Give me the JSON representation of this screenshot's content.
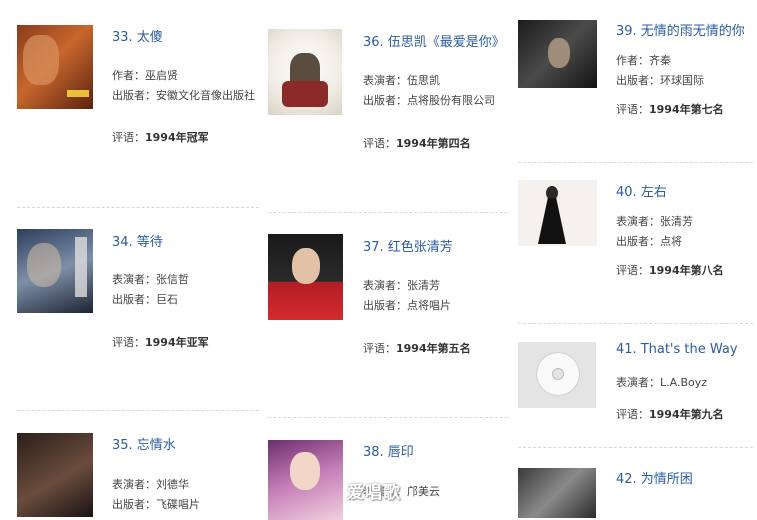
{
  "labels": {
    "author": "作者",
    "performer": "表演者",
    "publisher": "出版者",
    "review": "评语",
    "sep": "："
  },
  "albums": [
    {
      "num": "33.",
      "title": "太傻",
      "role": "author",
      "person": "巫启贤",
      "publisher": "安徽文化音像出版社",
      "review": "1994年冠军"
    },
    {
      "num": "34.",
      "title": "等待",
      "role": "performer",
      "person": "张信哲",
      "publisher": "巨石",
      "review": "1994年亚军"
    },
    {
      "num": "35.",
      "title": "忘情水",
      "role": "performer",
      "person": "刘德华",
      "publisher": "飞碟唱片",
      "review": ""
    },
    {
      "num": "36.",
      "title": "伍思凯《最爱是你》",
      "role": "performer",
      "person": "伍思凯",
      "publisher": "点将股份有限公司",
      "review": "1994年第四名"
    },
    {
      "num": "37.",
      "title": "红色张清芳",
      "role": "performer",
      "person": "张清芳",
      "publisher": "点将唱片",
      "review": "1994年第五名"
    },
    {
      "num": "38.",
      "title": "唇印",
      "role": "performer",
      "person": "邝美云",
      "publisher": "",
      "review": ""
    },
    {
      "num": "39.",
      "title": "无情的雨无情的你",
      "role": "author",
      "person": "齐秦",
      "publisher": "环球国际",
      "review": "1994年第七名"
    },
    {
      "num": "40.",
      "title": "左右",
      "role": "performer",
      "person": "张清芳",
      "publisher": "点将",
      "review": "1994年第八名"
    },
    {
      "num": "41.",
      "title": "That's the Way",
      "role": "performer",
      "person": "L.A.Boyz",
      "publisher": "",
      "review": "1994年第九名"
    },
    {
      "num": "42.",
      "title": "为情所困",
      "role": "",
      "person": "",
      "publisher": "",
      "review": ""
    }
  ],
  "watermark": "爱唱歌",
  "colors": {
    "link": "#2a5d9f",
    "divider": "#d8d8d8"
  }
}
